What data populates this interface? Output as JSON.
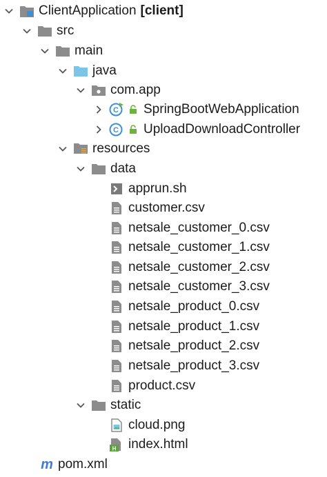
{
  "tree": {
    "root": {
      "name": "ClientApplication",
      "module_tag": "[client]",
      "icon": "module-folder-icon"
    },
    "src": {
      "name": "src",
      "icon": "folder-icon"
    },
    "main": {
      "name": "main",
      "icon": "folder-icon"
    },
    "java": {
      "name": "java",
      "icon": "source-root-folder-icon"
    },
    "package": {
      "name": "com.app",
      "icon": "package-icon"
    },
    "classes": [
      {
        "name": "SpringBootWebApplication",
        "icon": "spring-boot-class-icon"
      },
      {
        "name": "UploadDownloadController",
        "icon": "class-icon"
      }
    ],
    "resources": {
      "name": "resources",
      "icon": "resources-root-folder-icon"
    },
    "data": {
      "name": "data",
      "icon": "folder-icon"
    },
    "data_files": [
      {
        "name": "apprun.sh",
        "icon": "shell-script-icon"
      },
      {
        "name": "customer.csv",
        "icon": "text-file-icon"
      },
      {
        "name": "netsale_customer_0.csv",
        "icon": "text-file-icon"
      },
      {
        "name": "netsale_customer_1.csv",
        "icon": "text-file-icon"
      },
      {
        "name": "netsale_customer_2.csv",
        "icon": "text-file-icon"
      },
      {
        "name": "netsale_customer_3.csv",
        "icon": "text-file-icon"
      },
      {
        "name": "netsale_product_0.csv",
        "icon": "text-file-icon"
      },
      {
        "name": "netsale_product_1.csv",
        "icon": "text-file-icon"
      },
      {
        "name": "netsale_product_2.csv",
        "icon": "text-file-icon"
      },
      {
        "name": "netsale_product_3.csv",
        "icon": "text-file-icon"
      },
      {
        "name": "product.csv",
        "icon": "text-file-icon"
      }
    ],
    "static": {
      "name": "static",
      "icon": "folder-icon"
    },
    "static_files": [
      {
        "name": "cloud.png",
        "icon": "image-file-icon"
      },
      {
        "name": "index.html",
        "icon": "html-file-icon"
      }
    ],
    "pom": {
      "name": "pom.xml",
      "icon": "maven-icon"
    }
  },
  "colors": {
    "folder": "#8c8c8c",
    "source_root": "#7cc4e8",
    "class_circle": "#3d8fd6",
    "spring_green": "#6cb33e",
    "lock_green": "#6cb33e",
    "maven": "#3b7dd8",
    "html_green": "#5aa63a"
  }
}
